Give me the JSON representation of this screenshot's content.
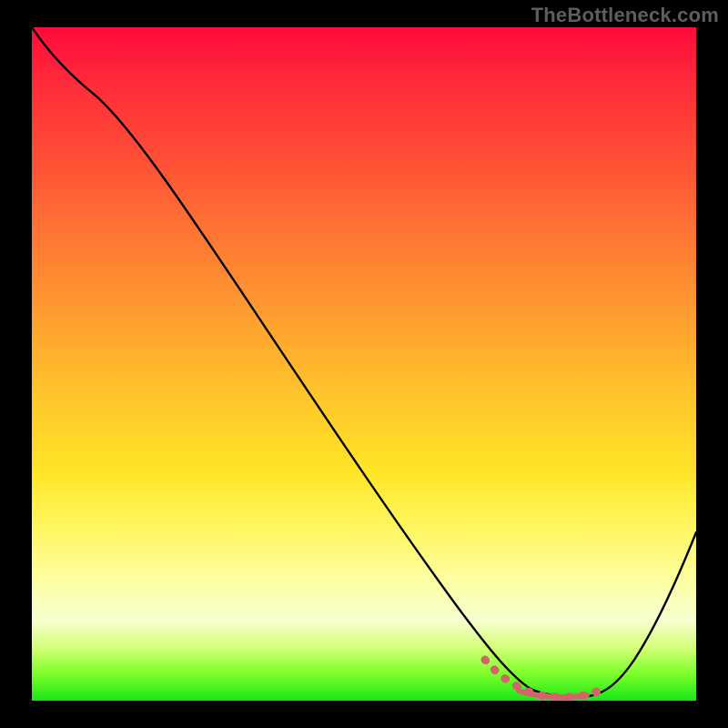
{
  "watermark": "TheBottleneck.com",
  "chart_data": {
    "type": "line",
    "title": "",
    "xlabel": "",
    "ylabel": "",
    "xlim": [
      0,
      100
    ],
    "ylim": [
      0,
      100
    ],
    "grid": false,
    "legend": false,
    "series": [
      {
        "name": "bottleneck-curve",
        "color": "#000000",
        "x": [
          0,
          5,
          10,
          20,
          30,
          40,
          50,
          60,
          66,
          70,
          74,
          78,
          82,
          86,
          90,
          95,
          100
        ],
        "y": [
          100,
          97,
          93,
          83,
          71,
          59,
          46,
          32,
          20,
          10,
          3,
          1,
          1,
          2,
          8,
          20,
          35
        ]
      },
      {
        "name": "highlight-band",
        "color": "#d4636a",
        "x": [
          69,
          71,
          73,
          75,
          77,
          79,
          81,
          83,
          85
        ],
        "y": [
          7,
          4,
          2,
          1,
          1,
          1,
          1,
          2,
          3
        ]
      }
    ],
    "background_gradient_stops": [
      {
        "pos": 0,
        "color": "#ff0a3a"
      },
      {
        "pos": 20,
        "color": "#ff5136"
      },
      {
        "pos": 44,
        "color": "#ffa22f"
      },
      {
        "pos": 66,
        "color": "#ffe527"
      },
      {
        "pos": 82,
        "color": "#fdffa0"
      },
      {
        "pos": 96,
        "color": "#7dff2a"
      },
      {
        "pos": 100,
        "color": "#19e619"
      }
    ]
  }
}
